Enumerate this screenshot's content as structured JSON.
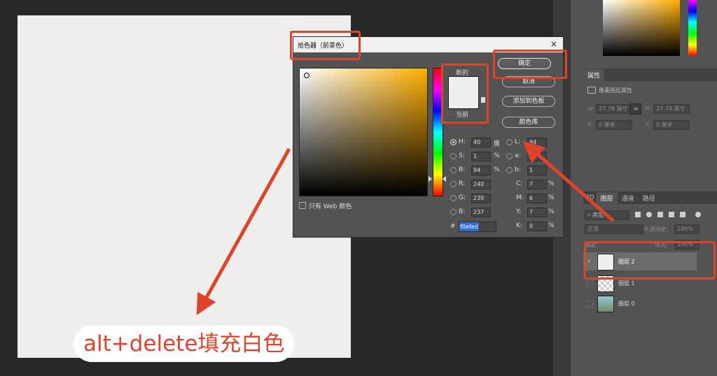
{
  "dialog": {
    "title": "拾色器（前景色）",
    "close": "×",
    "new_label": "新的",
    "current_label": "当前",
    "buttons": {
      "ok": "确定",
      "cancel": "取消",
      "add_swatch": "添加到色板",
      "color_library": "颜色库"
    },
    "web_only_label": "只有 Web 颜色",
    "fields": {
      "H": {
        "label": "H:",
        "value": "40",
        "unit": "度"
      },
      "S": {
        "label": "S:",
        "value": "1",
        "unit": "%"
      },
      "B": {
        "label": "B:",
        "value": "94",
        "unit": "%"
      },
      "R": {
        "label": "R:",
        "value": "240"
      },
      "G": {
        "label": "G:",
        "value": "239"
      },
      "Bl": {
        "label": "B:",
        "value": "237"
      },
      "L": {
        "label": "L:",
        "value": "94"
      },
      "a": {
        "label": "a:",
        "value": ""
      },
      "b": {
        "label": "b:",
        "value": "1"
      },
      "C": {
        "label": "C:",
        "value": "7",
        "unit": "%"
      },
      "M": {
        "label": "M:",
        "value": "6",
        "unit": "%"
      },
      "Y": {
        "label": "Y:",
        "value": "7",
        "unit": "%"
      },
      "K": {
        "label": "K:",
        "value": "0",
        "unit": "%"
      }
    },
    "hex_label": "#",
    "hex_value": "f0efed",
    "color": "#f0efed"
  },
  "properties_panel": {
    "tab": "属性",
    "subtitle": "像素图层属性",
    "w_label": "W:",
    "w_value": "27.78 英寸",
    "h_label": "H:",
    "h_value": "27.78 英寸",
    "x_label": "X:",
    "x_value": "0 厘米",
    "y_label": "Y:",
    "y_value": "0 厘米"
  },
  "layers_panel": {
    "tabs": [
      "3D",
      "图层",
      "通道",
      "路径"
    ],
    "active_tab": "图层",
    "kind_label": "类型",
    "blend_mode": "正常",
    "opacity_label": "不透明度:",
    "opacity_value": "100%",
    "lock_label": "锁定:",
    "fill_label": "填充:",
    "fill_value": "100%",
    "layers": [
      {
        "name": "图层 2",
        "selected": true
      },
      {
        "name": "图层 1",
        "selected": false
      },
      {
        "name": "图层 0",
        "selected": false
      }
    ]
  },
  "caption": "alt+delete填充白色",
  "colors": {
    "accent_annotation": "#e0432b",
    "canvas_fill": "#f0efed"
  }
}
